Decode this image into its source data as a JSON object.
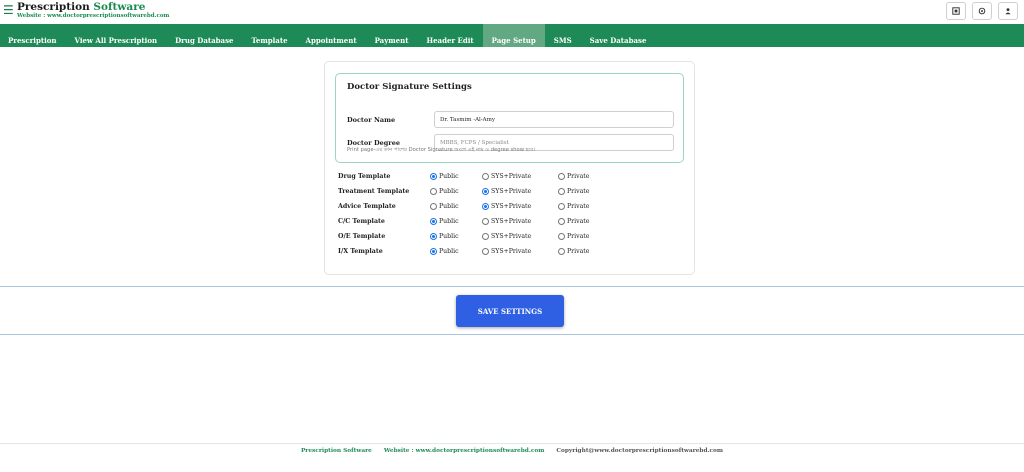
{
  "header": {
    "title_main": "Prescription",
    "title_accent": "Software",
    "website": "Website : www.doctorprescriptionsoftwarebd.com",
    "icons": [
      "expand-icon",
      "settings-icon",
      "user-icon"
    ]
  },
  "nav": {
    "items": [
      {
        "label": "Prescription"
      },
      {
        "label": "View All Prescription"
      },
      {
        "label": "Drug Database"
      },
      {
        "label": "Template"
      },
      {
        "label": "Appointment"
      },
      {
        "label": "Payment"
      },
      {
        "label": "Header Edit"
      },
      {
        "label": "Page Setup"
      },
      {
        "label": "SMS"
      },
      {
        "label": "Save Database"
      }
    ],
    "active": "Page Setup"
  },
  "signature": {
    "title": "Doctor Signature Settings",
    "name_label": "Doctor Name",
    "name_value": "Dr. Tasmim -Al-Amy",
    "degree_label": "Doctor Degree",
    "degree_placeholder": "MBBS, FCPS / Specialist",
    "note": "Print page-এর ডান পাশের Doctor Signature অংশে এই নাম ও degree show হবে।"
  },
  "templates": {
    "options": [
      "Public",
      "SYS+Private",
      "Private"
    ],
    "rows": [
      {
        "label": "Drug Template",
        "selected": "Public"
      },
      {
        "label": "Treatment Template",
        "selected": "SYS+Private"
      },
      {
        "label": "Advice Template",
        "selected": "SYS+Private"
      },
      {
        "label": "C/C Template",
        "selected": "Public"
      },
      {
        "label": "O/E Template",
        "selected": "Public"
      },
      {
        "label": "I/X Template",
        "selected": "Public"
      }
    ]
  },
  "actions": {
    "save_label": "SAVE SETTINGS"
  },
  "footer": {
    "brand": "Prescription Software",
    "website": "Website : www.doctorprescriptionsoftwarebd.com",
    "copyright": "Copyright@www.doctorprescriptionsoftwarebd.com"
  },
  "colors": {
    "brand_green": "#1e8a57",
    "active_tab": "#62a883",
    "primary_button": "#2f5fe3",
    "radio_selected": "#1a73e8"
  }
}
